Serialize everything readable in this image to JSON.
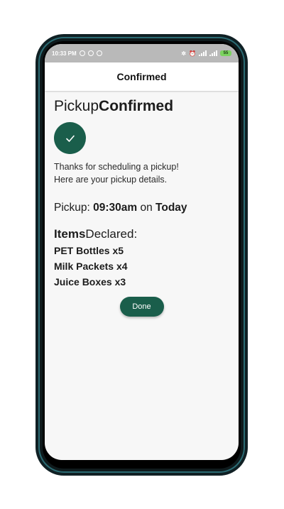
{
  "statusbar": {
    "time": "10:33 PM",
    "battery": "55"
  },
  "appbar": {
    "title": "Confirmed"
  },
  "heading": {
    "part1": "Pickup",
    "part2": "Confirmed"
  },
  "check_icon": "check-icon",
  "thanks": {
    "line1": "Thanks for scheduling a pickup!",
    "line2": "Here are your pickup details."
  },
  "pickup": {
    "label": "Pickup: ",
    "time": "09:30am",
    "on": " on ",
    "day": "Today"
  },
  "items": {
    "head_bold": "Items",
    "head_rest": "Declared:",
    "list": [
      "PET Bottles x5",
      "Milk Packets x4",
      "Juice Boxes x3"
    ]
  },
  "done_button": "Done",
  "colors": {
    "accent": "#1a5e4b",
    "statusbar": "#b9b9b9"
  }
}
